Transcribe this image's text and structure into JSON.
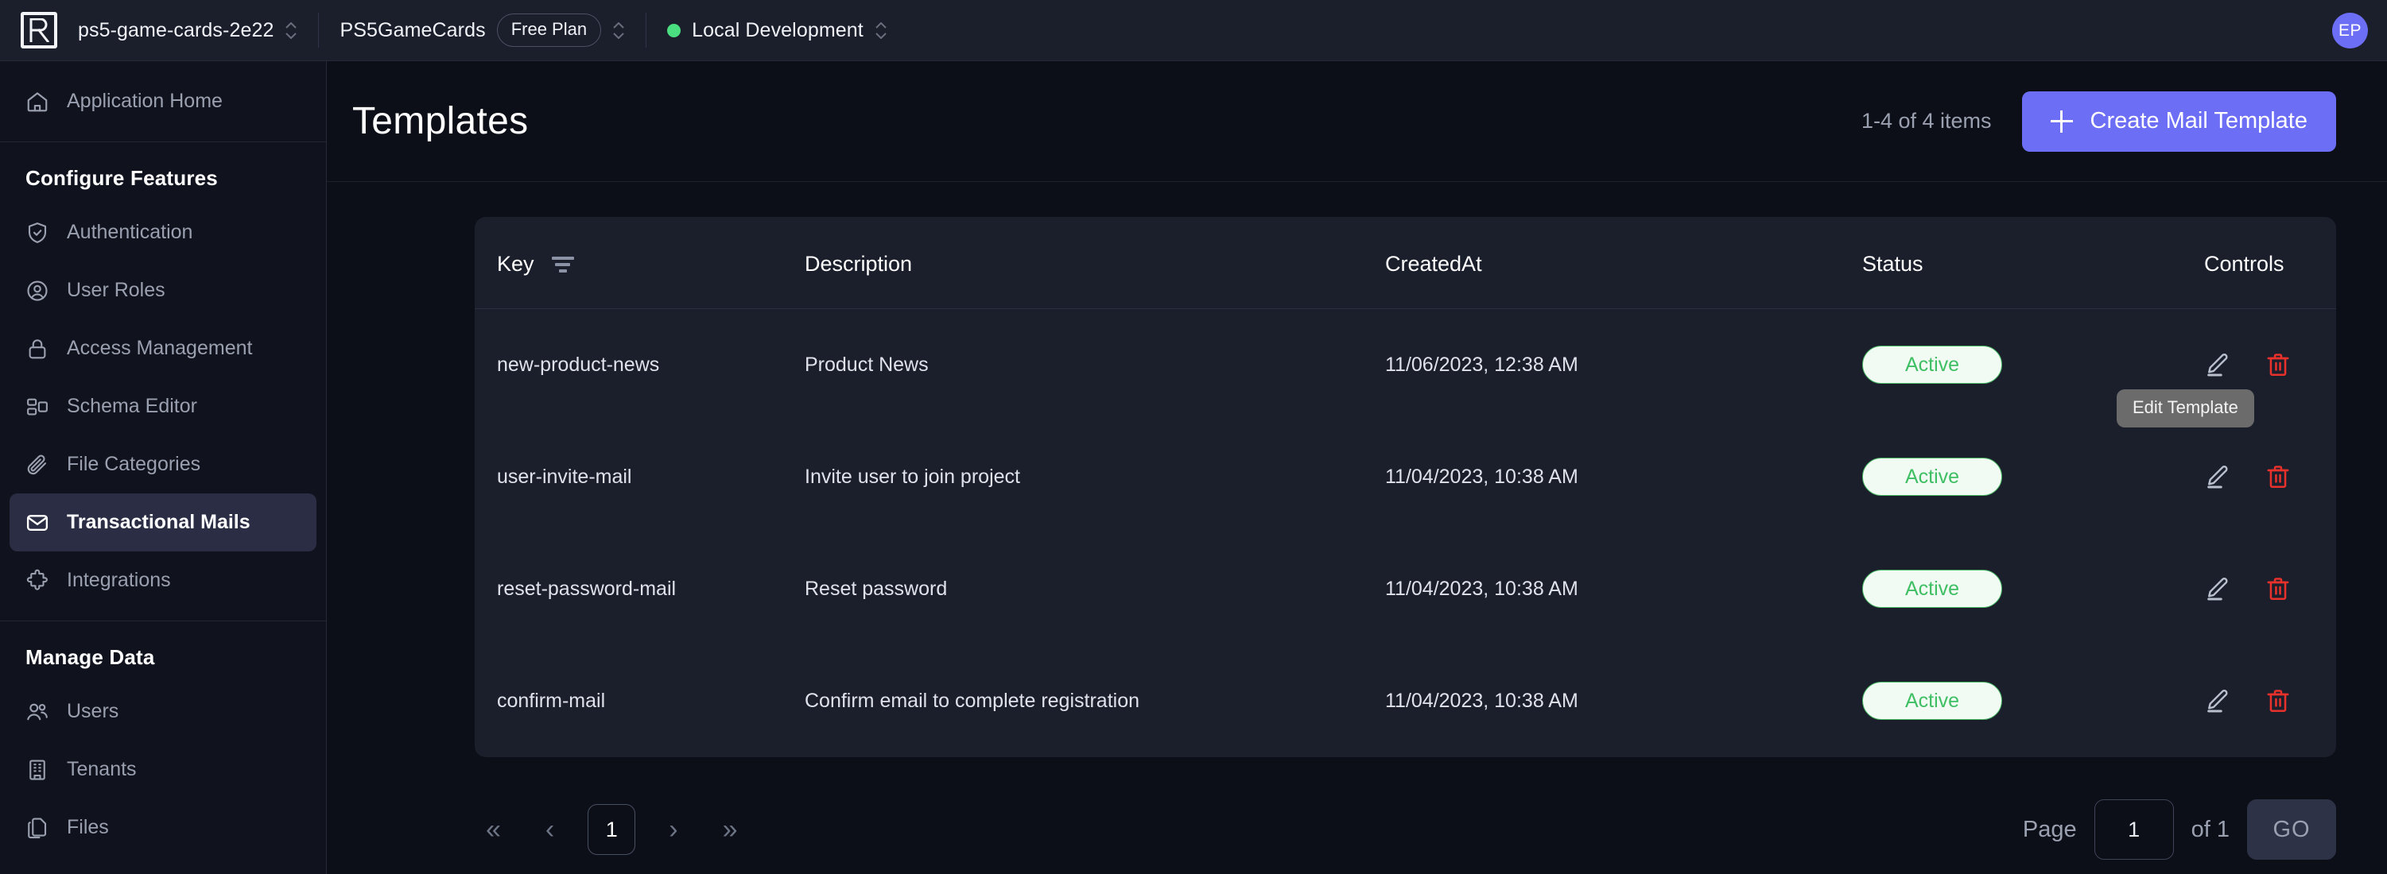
{
  "topbar": {
    "logo_letter": "R",
    "project": {
      "name": "ps5-game-cards-2e22"
    },
    "app": {
      "name": "PS5GameCards",
      "plan_badge": "Free Plan"
    },
    "environment": {
      "name": "Local Development",
      "status_color": "#4ade80"
    },
    "avatar": {
      "initials": "EP",
      "color": "#6c6ef5"
    }
  },
  "sidebar": {
    "home": {
      "label": "Application Home",
      "icon": "home-icon"
    },
    "sections": [
      {
        "title": "Configure Features",
        "items": [
          {
            "label": "Authentication",
            "icon": "shield-check-icon",
            "active": false
          },
          {
            "label": "User Roles",
            "icon": "user-circle-icon",
            "active": false
          },
          {
            "label": "Access Management",
            "icon": "lock-icon",
            "active": false
          },
          {
            "label": "Schema Editor",
            "icon": "schema-icon",
            "active": false
          },
          {
            "label": "File Categories",
            "icon": "paperclip-icon",
            "active": false
          },
          {
            "label": "Transactional Mails",
            "icon": "mail-icon",
            "active": true
          },
          {
            "label": "Integrations",
            "icon": "puzzle-icon",
            "active": false
          }
        ]
      },
      {
        "title": "Manage Data",
        "items": [
          {
            "label": "Users",
            "icon": "users-icon",
            "active": false
          },
          {
            "label": "Tenants",
            "icon": "building-icon",
            "active": false
          },
          {
            "label": "Files",
            "icon": "files-icon",
            "active": false
          }
        ]
      }
    ]
  },
  "page": {
    "title": "Templates",
    "items_count": "1-4 of 4 items",
    "create_button": {
      "label": "Create Mail Template",
      "icon": "plus-icon",
      "color": "#6c6ef5"
    }
  },
  "table": {
    "columns": [
      "Key",
      "Description",
      "CreatedAt",
      "Status",
      "Controls"
    ],
    "key_filter_icon": "filter-icon",
    "rows": [
      {
        "key": "new-product-news",
        "description": "Product News",
        "created_at": "11/06/2023, 12:38 AM",
        "status": "Active"
      },
      {
        "key": "user-invite-mail",
        "description": "Invite user to join project",
        "created_at": "11/04/2023, 10:38 AM",
        "status": "Active"
      },
      {
        "key": "reset-password-mail",
        "description": "Reset password",
        "created_at": "11/04/2023, 10:38 AM",
        "status": "Active"
      },
      {
        "key": "confirm-mail",
        "description": "Confirm email to complete registration",
        "created_at": "11/04/2023, 10:38 AM",
        "status": "Active"
      }
    ],
    "row_actions": {
      "edit_icon": "pencil-icon",
      "delete_icon": "trash-icon"
    },
    "tooltip": {
      "text": "Edit Template",
      "on_row_index": 1
    },
    "status_colors": {
      "active_text": "#3fbf63",
      "active_bg": "#f1faf3",
      "active_border": "#48b863"
    }
  },
  "pagination": {
    "first_label": "«",
    "prev_label": "‹",
    "current_page": "1",
    "next_label": "›",
    "last_label": "»",
    "page_label": "Page",
    "page_input_value": "1",
    "of_label": "of 1",
    "go_label": "GO"
  }
}
